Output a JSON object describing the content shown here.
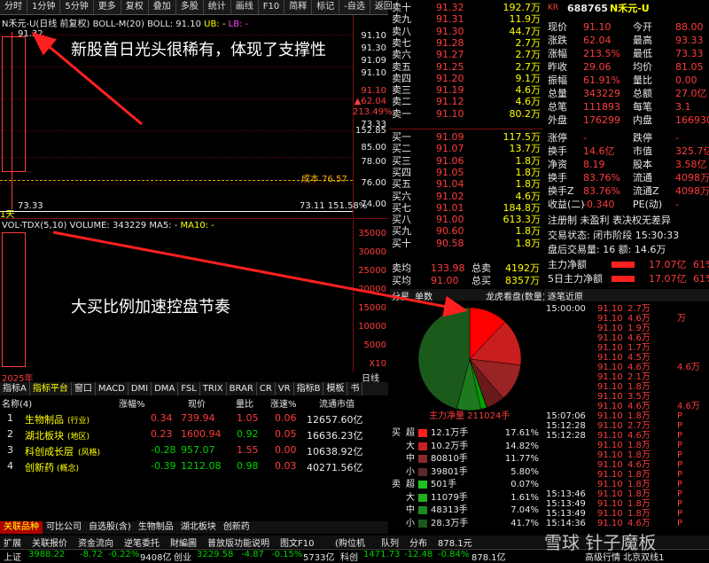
{
  "toolbar": [
    "分时",
    "1分钟",
    "5分钟",
    "更多",
    "复权",
    "叠加",
    "多股",
    "统计",
    "画线",
    "F10",
    "简释",
    "标记",
    "-自选",
    "返回"
  ],
  "kline": {
    "title": "N禾元-U(日线 前复权)",
    "indicator": "BOLL-M(20)",
    "boll": "BOLL: 91.10",
    "ub": "UB: -",
    "lb": "LB: -",
    "high_label": "91.32",
    "low_label": "73.33",
    "cost_label": "成本 76.57",
    "low_pct": "73.11 151.58%",
    "right_axis": [
      "91.10",
      "91.30",
      "91.09",
      "91.10",
      "91.10",
      "▲62.04",
      "213.49%",
      "73.33",
      "152.85",
      "85.00",
      "78.00",
      "76.00",
      "74.00"
    ],
    "day_label": "1天"
  },
  "vol": {
    "title": "VOL-TDX(5,10)",
    "volume": "VOLUME: 343229",
    "ma5": "MA5: -",
    "ma10": "MA10: -",
    "right_axis": [
      "35000",
      "30000",
      "25000",
      "20000",
      "15000",
      "10000",
      "5000",
      "X10"
    ],
    "year": "2025年",
    "day": "日线"
  },
  "indtabs": [
    "指标A",
    "指标平台",
    "窗口",
    "MACD",
    "DMI",
    "DMA",
    "FSL",
    "TRIX",
    "BRAR",
    "CR",
    "VR",
    "指标B",
    "模板",
    "书"
  ],
  "sector": {
    "headers": [
      "名称(4)",
      "涨幅%",
      "现价",
      "量比",
      "涨速%",
      "流通市值"
    ],
    "rows": [
      {
        "n": "1",
        "name": "生物制品",
        "tag": "(行业)",
        "chg": "0.34",
        "price": "739.94",
        "lb": "1.05",
        "speed": "0.06",
        "mv": "12657.60亿",
        "up": true
      },
      {
        "n": "2",
        "name": "湖北板块",
        "tag": "(地区)",
        "chg": "0.23",
        "price": "1600.94",
        "lb": "0.92",
        "speed": "0.05",
        "mv": "16636.23亿",
        "up": true
      },
      {
        "n": "3",
        "name": "科创成长层",
        "tag": "(风格)",
        "chg": "-0.28",
        "price": "957.07",
        "lb": "1.55",
        "speed": "0.00",
        "mv": "10638.92亿",
        "up": false
      },
      {
        "n": "4",
        "name": "创新药",
        "tag": "(概念)",
        "chg": "-0.39",
        "price": "1212.08",
        "lb": "0.98",
        "speed": "0.03",
        "mv": "40271.56亿",
        "up": false
      }
    ]
  },
  "bottabs": [
    "关联品种",
    "可比公司",
    "自选股(含)",
    "生物制品",
    "湖北板块",
    "创新药"
  ],
  "mainbar": [
    "扩展",
    "关联报价",
    "资金流向",
    "逆笔委托",
    "財編圖",
    "普放版功能说明",
    "图文F10",
    "(购位机",
    "队列",
    "分布",
    "878.1元"
  ],
  "book": {
    "sell": [
      [
        "卖十",
        "91.32",
        "192.7万"
      ],
      [
        "卖九",
        "91.31",
        "11.9万"
      ],
      [
        "卖八",
        "91.30",
        "44.7万"
      ],
      [
        "卖七",
        "91.28",
        "2.7万"
      ],
      [
        "卖六",
        "91.27",
        "2.7万"
      ],
      [
        "卖五",
        "91.25",
        "2.7万"
      ],
      [
        "卖四",
        "91.20",
        "9.1万"
      ],
      [
        "卖三",
        "91.19",
        "4.6万"
      ],
      [
        "卖二",
        "91.12",
        "4.6万"
      ],
      [
        "卖一",
        "91.10",
        "80.2万"
      ]
    ],
    "buy": [
      [
        "买一",
        "91.09",
        "117.5万"
      ],
      [
        "买二",
        "91.07",
        "13.7万"
      ],
      [
        "买三",
        "91.06",
        "1.8万"
      ],
      [
        "买四",
        "91.05",
        "1.8万"
      ],
      [
        "买五",
        "91.04",
        "1.8万"
      ],
      [
        "买六",
        "91.02",
        "4.6万"
      ],
      [
        "买七",
        "91.01",
        "184.8万"
      ],
      [
        "买八",
        "91.00",
        "613.3万"
      ],
      [
        "买九",
        "90.60",
        "1.8万"
      ],
      [
        "买十",
        "90.58",
        "1.8万"
      ]
    ],
    "avg_sell": [
      "卖均",
      "133.98",
      "总卖",
      "4192万"
    ],
    "avg_buy": [
      "买均",
      "91.00",
      "总买",
      "8357万"
    ],
    "sell_flag": "¥"
  },
  "quote": {
    "code": "688765",
    "market": "KR",
    "name": "N禾元-U",
    "rows": [
      [
        "现价",
        "91.10",
        "今开",
        "88.00"
      ],
      [
        "涨跌",
        "62.04",
        "最高",
        "93.33"
      ],
      [
        "涨幅",
        "213.5%",
        "最低",
        "73.33"
      ],
      [
        "昨收",
        "29.06",
        "均价",
        "81.05"
      ],
      [
        "振幅",
        "61.91%",
        "量比",
        "0.00"
      ],
      [
        "总量",
        "343229",
        "总额",
        "27.0亿"
      ],
      [
        "总笔",
        "111893",
        "每笔",
        "3.1"
      ],
      [
        "外盘",
        "176299",
        "内盘",
        "166930"
      ]
    ],
    "rows2": [
      [
        "涨停",
        "-",
        "跌停",
        "-"
      ],
      [
        "换手",
        "14.6亿",
        "市值",
        "325.7亿"
      ],
      [
        "净资",
        "8.19",
        "股本",
        "3.58亿"
      ],
      [
        "换手",
        "83.76%",
        "流通",
        "4098万"
      ],
      [
        "换手Z",
        "83.76%",
        "流通Z",
        "4098万"
      ],
      [
        "收益(二)",
        "-0.340",
        "PE(动)",
        "-"
      ]
    ],
    "reg": "注册制 未盈利 表决权无差异",
    "state": "交易状态: 闭市阶段 15:30:33",
    "after": "盘后交易量: 16 额: 14.6万",
    "inflow": [
      "主力净额",
      "17.07亿",
      "61%"
    ],
    "inflow5": [
      "5日主力净额",
      "17.07亿",
      "61%"
    ]
  },
  "pie": {
    "tabs": [
      "分星",
      "单数",
      "龙虎看盘(数量)"
    ],
    "label": "主力净量 211024手",
    "slices": [
      {
        "v": 12.1,
        "c": "#ff0000"
      },
      {
        "v": 14.8,
        "c": "#c81e1e"
      },
      {
        "v": 11.8,
        "c": "#9a2323"
      },
      {
        "v": 5.8,
        "c": "#6a1a1a"
      },
      {
        "v": 0.1,
        "c": "#00b000"
      },
      {
        "v": 1.9,
        "c": "#00a000"
      },
      {
        "v": 7.6,
        "c": "#1e7a1e"
      },
      {
        "v": 45.9,
        "c": "#1c5a1c"
      }
    ]
  },
  "flow": {
    "sell_label": "买",
    "buy_label": "卖",
    "rows": [
      [
        "超",
        "12.1万手",
        "17.61%",
        "#ff2020"
      ],
      [
        "大",
        "10.2万手",
        "14.82%",
        "#c82020"
      ],
      [
        "中",
        "80810手",
        "11.77%",
        "#8a2a2a"
      ],
      [
        "小",
        "39801手",
        "5.80%",
        "#5a2a2a"
      ],
      [
        "超",
        "501手",
        "0.07%",
        "#20c020"
      ],
      [
        "大",
        "11079手",
        "1.61%",
        "#20b020"
      ],
      [
        "中",
        "48313手",
        "7.04%",
        "#1e8a1e"
      ],
      [
        "小",
        "28.3万手",
        "41.7%",
        "#1a5a1a"
      ]
    ]
  },
  "ticks": {
    "tabs": [
      "逐笔近原"
    ],
    "rows": [
      [
        "15:00:00",
        "91.10",
        "2.7万",
        ""
      ],
      [
        "",
        "91.10",
        "4.6万",
        "万"
      ],
      [
        "",
        "91.10",
        "1.9万",
        ""
      ],
      [
        "",
        "91.10",
        "4.6万",
        ""
      ],
      [
        "",
        "91.10",
        "1.7万",
        ""
      ],
      [
        "",
        "91.10",
        "4.5万",
        ""
      ],
      [
        "",
        "91.10",
        "4.6万",
        "4.6万"
      ],
      [
        "",
        "91.10",
        "2.1万",
        ""
      ],
      [
        "",
        "91.10",
        "1.8万",
        ""
      ],
      [
        "",
        "91.10",
        "3.5万",
        ""
      ],
      [
        "",
        "91.10",
        "4.6万",
        "4.6万"
      ],
      [
        "15:07:06",
        "91.10",
        "1.8万",
        "P"
      ],
      [
        "15:12:28",
        "91.10",
        "2.7万",
        "P"
      ],
      [
        "15:12:28",
        "91.10",
        "4.6万",
        "P"
      ],
      [
        "",
        "91.10",
        "1.8万",
        "P"
      ],
      [
        "",
        "91.10",
        "1.8万",
        "P"
      ],
      [
        "",
        "91.10",
        "4.6万",
        "P"
      ],
      [
        "",
        "91.10",
        "1.8万",
        "P"
      ],
      [
        "",
        "91.10",
        "1.8万",
        "P"
      ],
      [
        "15:13:46",
        "91.10",
        "1.8万",
        "P"
      ],
      [
        "15:13:49",
        "91.10",
        "1.8万",
        "P"
      ],
      [
        "15:13:49",
        "91.10",
        "1.8万",
        "P"
      ],
      [
        "15:14:36",
        "91.10",
        "4.6万",
        "P"
      ]
    ]
  },
  "status": {
    "sh": "上证",
    "sh_v": "3988.22",
    "sh_c": "-8.72",
    "sh_p": "-0.22%",
    "sh_a": "9408亿",
    "cy": "创业",
    "cy_v": "3229.58",
    "cy_c": "-4.87",
    "cy_p": "-0.15%",
    "cy_a": "5733亿",
    "kc": "科创",
    "kc_v": "1471.73",
    "kc_c": "-12.48",
    "kc_p": "-0.84%",
    "kc_a": "878.1亿",
    "right": "高级行情 北京双线1"
  },
  "notes": {
    "n1": "新股首日光头很稀有，体现了支撑性",
    "n2": "大买比例加速控盘节奏",
    "wm": "雪球 针子魔板"
  }
}
